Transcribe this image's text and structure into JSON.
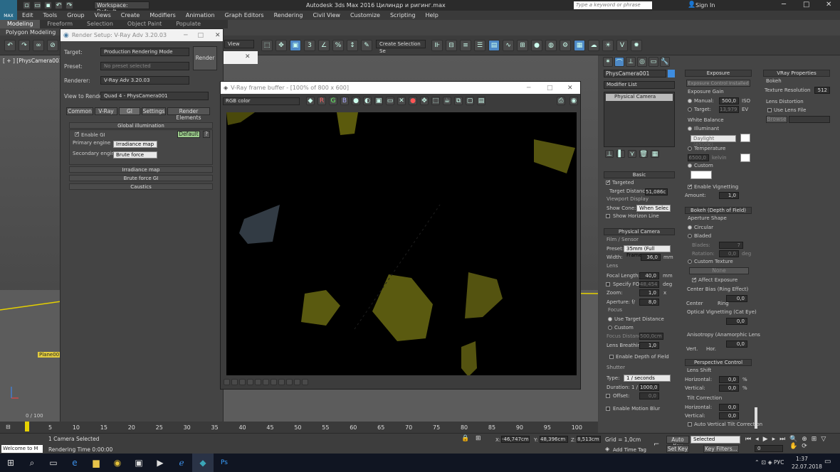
{
  "window": {
    "title": "Autodesk 3ds Max 2016   Цилиндр и ригинг.max",
    "workspace": "Workspace: Default",
    "search_placeholder": "Type a keyword or phrase",
    "sign_in": "Sign In",
    "app_badge": "MAX"
  },
  "menu": [
    "Edit",
    "Tools",
    "Group",
    "Views",
    "Create",
    "Modifiers",
    "Animation",
    "Graph Editors",
    "Rendering",
    "Civil View",
    "Customize",
    "Scripting",
    "Help"
  ],
  "ribbon": {
    "tabs": [
      "Modeling",
      "Freeform",
      "Selection",
      "Object Paint",
      "Populate"
    ],
    "sub": "Polygon Modeling",
    "view_dropdown": "View",
    "named_selection": "Create Selection Se"
  },
  "viewport": {
    "label": "[ + ] [PhysCamera001 ] [Sh",
    "plane_label": "Plane001"
  },
  "render_setup": {
    "title": "Render Setup: V-Ray Adv 3.20.03",
    "target_label": "Target:",
    "target_value": "Production Rendering Mode",
    "preset_label": "Preset:",
    "preset_value": "No preset selected",
    "renderer_label": "Renderer:",
    "renderer_value": "V-Ray Adv 3.20.03",
    "view_label": "View to Render:",
    "view_value": "Quad 4 - PhysCamera001",
    "render_btn": "Render",
    "tabs": [
      "Common",
      "V-Ray",
      "GI",
      "Settings",
      "Render Elements"
    ],
    "gi_rollout": "Global illumination",
    "enable_gi": "Enable GI",
    "default_btn": "Default",
    "help_btn": "?",
    "primary_label": "Primary engine",
    "primary_value": "Irradiance map",
    "secondary_label": "Secondary engine",
    "secondary_value": "Brute force",
    "rollouts": [
      "Irradiance map",
      "Brute force GI",
      "Caustics"
    ]
  },
  "vfb": {
    "title": "V-Ray frame buffer - [100% of 800 x 600]",
    "channel": "RGB color",
    "rgb": [
      "R",
      "G",
      "B"
    ]
  },
  "command_panel": {
    "object_name": "PhysCamera001",
    "modifier_list": "Modifier List",
    "stack_item": "Physical Camera",
    "basic": {
      "header": "Basic",
      "targeted": "Targeted",
      "target_distance_label": "Target Distance:",
      "target_distance": "51,086c",
      "viewport_display": "Viewport Display",
      "show_cone_label": "Show Cone:",
      "show_cone": "When Selec",
      "show_horizon": "Show Horizon Line"
    },
    "physical_camera": {
      "header": "Physical Camera",
      "film_sensor": "Film / Sensor",
      "preset_label": "Preset:",
      "preset": "35mm (Full Frame",
      "width_label": "Width:",
      "width": "36,0",
      "width_unit": "mm",
      "lens": "Lens",
      "focal_label": "Focal Length:",
      "focal": "40,0",
      "focal_unit": "mm",
      "specify_fov": "Specify FOV:",
      "fov": "48,454",
      "fov_unit": "deg",
      "zoom_label": "Zoom:",
      "zoom": "1,0",
      "zoom_unit": "x",
      "aperture_label": "Aperture: f/",
      "aperture": "8,0",
      "focus": "Focus",
      "use_target": "Use Target Distance",
      "custom": "Custom",
      "focus_dist_label": "Focus Distance:",
      "focus_dist": "500,0cm",
      "lens_breathing_label": "Lens Breathing:",
      "lens_breathing": "1,0",
      "enable_dof": "Enable Depth of Field",
      "shutter": "Shutter",
      "type_label": "Type:",
      "type": "1 / seconds",
      "duration_label": "Duration: 1 /",
      "duration": "1000,0",
      "offset_label": "Offset:",
      "offset": "0,0",
      "motion_blur": "Enable Motion Blur"
    },
    "exposure": {
      "header": "Exposure",
      "control_btn": "Exposure Control Installed",
      "gain": "Exposure Gain",
      "manual": "Manual:",
      "manual_value": "500,0",
      "iso": "ISO",
      "target": "Target:",
      "target_value": "13,979",
      "ev": "EV",
      "white_balance": "White Balance",
      "illuminant": "Illuminant",
      "daylight": "Daylight (6500K)",
      "temperature": "Temperature",
      "temperature_value": "6500,0",
      "kelvin": "kelvin",
      "custom": "Custom",
      "vignetting": "Enable Vignetting",
      "amount_label": "Amount:",
      "amount": "1,0"
    },
    "bokeh": {
      "header": "Bokeh (Depth of Field)",
      "aperture_shape": "Aperture Shape",
      "circular": "Circular",
      "bladed": "Bladed",
      "blades_label": "Blades:",
      "blades": "7",
      "rotation_label": "Rotation:",
      "rotation": "0,0",
      "rotation_unit": "deg",
      "custom_texture": "Custom Texture",
      "none_btn": "None",
      "affect_exposure": "Affect Exposure",
      "center_bias": "Center Bias (Ring Effect)",
      "center_bias_value": "0,0",
      "center": "Center",
      "ring": "Ring",
      "optical_vignetting": "Optical Vignetting (Cat Eye)",
      "optical_value": "0,0",
      "anisotropy": "Anisotropy (Anamorphic Lens",
      "anisotropy_value": "0,0",
      "vert": "Vert.",
      "hor": "Hor."
    },
    "perspective": {
      "header": "Perspective Control",
      "lens_shift": "Lens Shift",
      "horizontal_label": "Horizontal:",
      "horizontal": "0,0",
      "vertical_label": "Vertical:",
      "vertical": "0,0",
      "pct": "%",
      "tilt": "Tilt Correction",
      "tilt_h": "0,0",
      "tilt_v": "0,0",
      "auto_tilt": "Auto Vertical Tilt Correction"
    },
    "vray": {
      "header": "VRay Properties",
      "bokeh": "Bokeh",
      "tex_res_label": "Texture Resolution",
      "tex_res": "512",
      "lens_distortion": "Lens Distortion",
      "use_lens_file": "Use Lens File",
      "browse": "Browse"
    }
  },
  "timeline": {
    "frame": "0 / 100",
    "ticks": [
      "5",
      "10",
      "15",
      "20",
      "25",
      "30",
      "35",
      "40",
      "45",
      "50",
      "55",
      "60",
      "65",
      "70",
      "75",
      "80",
      "85",
      "90",
      "95",
      "100"
    ]
  },
  "status": {
    "welcome": "Welcome to M",
    "selected": "1 Camera Selected",
    "rendering": "Rendering Time  0:00:00",
    "x_label": "X:",
    "x": "-46,747cm",
    "y_label": "Y:",
    "y": "48,396cm",
    "z_label": "Z:",
    "z": "8,513cm",
    "grid": "Grid = 1,0cm",
    "add_time_tag": "Add Time Tag",
    "auto_key": "Auto Key",
    "selected_dd": "Selected",
    "set_key": "Set Key",
    "key_filters": "Key Filters...",
    "frame": "0"
  },
  "taskbar": {
    "lang": "РУС",
    "time": "1:37",
    "date": "22.07.2018"
  },
  "colors": {
    "accent": "#4e89c6",
    "object_yellow": "#6e6a10",
    "object_blue": "#2f3a44"
  }
}
